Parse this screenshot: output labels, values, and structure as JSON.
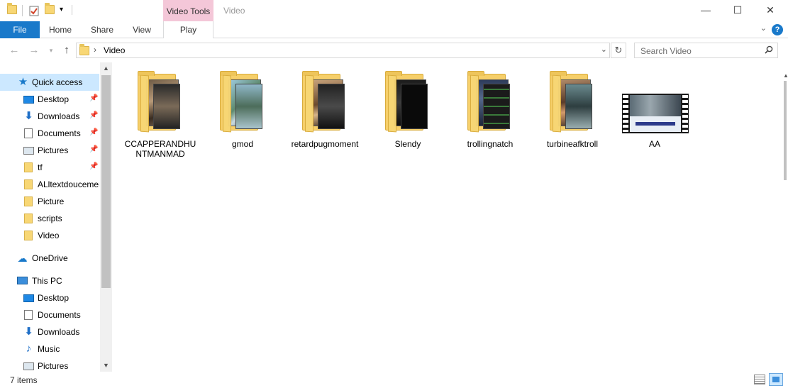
{
  "window": {
    "title": "Video",
    "contextual_tab": "Video Tools",
    "controls": {
      "minimize": "—",
      "maximize": "☐",
      "close": "✕"
    }
  },
  "ribbon": {
    "tabs": [
      "File",
      "Home",
      "Share",
      "View",
      "Play"
    ],
    "help": "?"
  },
  "address": {
    "breadcrumb": "Video",
    "separator": "›"
  },
  "search": {
    "placeholder": "Search Video"
  },
  "nav": {
    "quick_access": "Quick access",
    "pinned": [
      {
        "label": "Desktop",
        "icon": "desktop-icon"
      },
      {
        "label": "Downloads",
        "icon": "downloads-icon"
      },
      {
        "label": "Documents",
        "icon": "documents-icon"
      },
      {
        "label": "Pictures",
        "icon": "pictures-icon"
      },
      {
        "label": "tf",
        "icon": "folder-icon"
      }
    ],
    "recent": [
      "ALltextdoucement",
      "Picture",
      "scripts",
      "Video"
    ],
    "onedrive": "OneDrive",
    "this_pc": "This PC",
    "pc_items": [
      "Desktop",
      "Documents",
      "Downloads",
      "Music",
      "Pictures"
    ]
  },
  "files": [
    {
      "name": "CCAPPERANDHUNTMANMAD",
      "type": "folder"
    },
    {
      "name": "gmod",
      "type": "folder"
    },
    {
      "name": "retardpugmoment",
      "type": "folder"
    },
    {
      "name": "Slendy",
      "type": "folder"
    },
    {
      "name": "trollingnatch",
      "type": "folder"
    },
    {
      "name": "turbineafktroll",
      "type": "folder"
    },
    {
      "name": "AA",
      "type": "video"
    }
  ],
  "status": {
    "item_count": "7 items"
  },
  "colors": {
    "accent": "#1979ca",
    "contextual": "#f4c7d8",
    "folder": "#f8d775",
    "selection": "#cce8ff"
  }
}
